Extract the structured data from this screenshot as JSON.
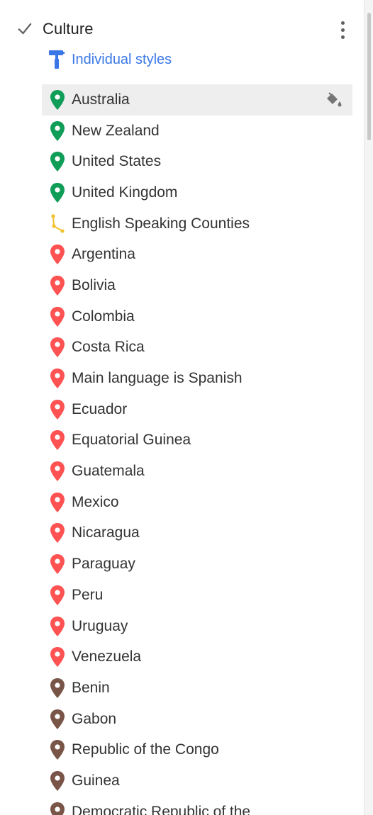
{
  "layer": {
    "title": "Culture",
    "checked": true,
    "style_label": "Individual styles"
  },
  "colors": {
    "green": "#0f9d58",
    "red": "#ff5252",
    "brown": "#795548",
    "line_yellow": "#f2c12e",
    "link_blue": "#3b78e7"
  },
  "features": [
    {
      "label": "Australia",
      "type": "point",
      "color": "green",
      "selected": true
    },
    {
      "label": "New Zealand",
      "type": "point",
      "color": "green"
    },
    {
      "label": "United States",
      "type": "point",
      "color": "green"
    },
    {
      "label": "United Kingdom",
      "type": "point",
      "color": "green"
    },
    {
      "label": "English Speaking Counties",
      "type": "line",
      "color": "line_yellow"
    },
    {
      "label": "Argentina",
      "type": "point",
      "color": "red"
    },
    {
      "label": "Bolivia",
      "type": "point",
      "color": "red"
    },
    {
      "label": "Colombia",
      "type": "point",
      "color": "red"
    },
    {
      "label": "Costa Rica",
      "type": "point",
      "color": "red"
    },
    {
      "label": "Main language is Spanish",
      "type": "point",
      "color": "red"
    },
    {
      "label": "Ecuador",
      "type": "point",
      "color": "red"
    },
    {
      "label": "Equatorial Guinea",
      "type": "point",
      "color": "red"
    },
    {
      "label": "Guatemala",
      "type": "point",
      "color": "red"
    },
    {
      "label": "Mexico",
      "type": "point",
      "color": "red"
    },
    {
      "label": "Nicaragua",
      "type": "point",
      "color": "red"
    },
    {
      "label": "Paraguay",
      "type": "point",
      "color": "red"
    },
    {
      "label": "Peru",
      "type": "point",
      "color": "red"
    },
    {
      "label": "Uruguay",
      "type": "point",
      "color": "red"
    },
    {
      "label": "Venezuela",
      "type": "point",
      "color": "red"
    },
    {
      "label": "Benin",
      "type": "point",
      "color": "brown"
    },
    {
      "label": "Gabon",
      "type": "point",
      "color": "brown"
    },
    {
      "label": "Republic of the Congo",
      "type": "point",
      "color": "brown"
    },
    {
      "label": "Guinea",
      "type": "point",
      "color": "brown"
    },
    {
      "label": "Democratic Republic of the",
      "type": "point",
      "color": "brown"
    }
  ]
}
